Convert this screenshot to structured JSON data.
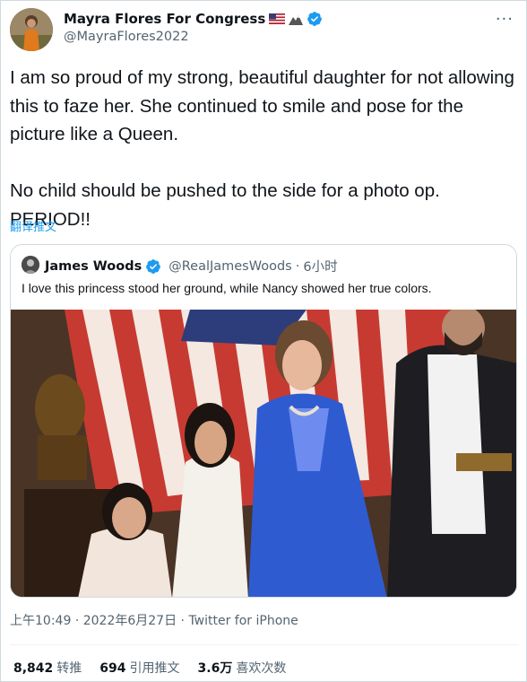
{
  "author": {
    "display_name": "Mayra Flores For Congress",
    "handle": "@MayraFlores2022",
    "name_emoji": [
      "us-flag-icon",
      "mountain-icon"
    ],
    "verified": true
  },
  "more_label": "···",
  "tweet": {
    "text": "I am so proud of my strong, beautiful daughter for not allowing this to faze her. She continued to smile and pose for the picture like a Queen.\n\nNo child should be pushed to the side for a photo op. PERIOD!!",
    "translate_label": "翻译推文"
  },
  "quote": {
    "name": "James Woods",
    "handle": "@RealJamesWoods",
    "sep": "·",
    "time": "6小时",
    "text": "I love this princess stood her ground, while Nancy showed her true colors.",
    "verified": true
  },
  "meta": {
    "time": "上午10:49",
    "sep1": "·",
    "date": "2022年6月27日",
    "sep2": "·",
    "source": "Twitter for iPhone"
  },
  "stats": {
    "retweets_count": "8,842",
    "retweets_label": "转推",
    "quotes_count": "694",
    "quotes_label": "引用推文",
    "likes_count": "3.6万",
    "likes_label": "喜欢次数"
  },
  "colors": {
    "accent": "#1d9bf0",
    "secondary_text": "#536471",
    "primary_text": "#0f1419"
  }
}
